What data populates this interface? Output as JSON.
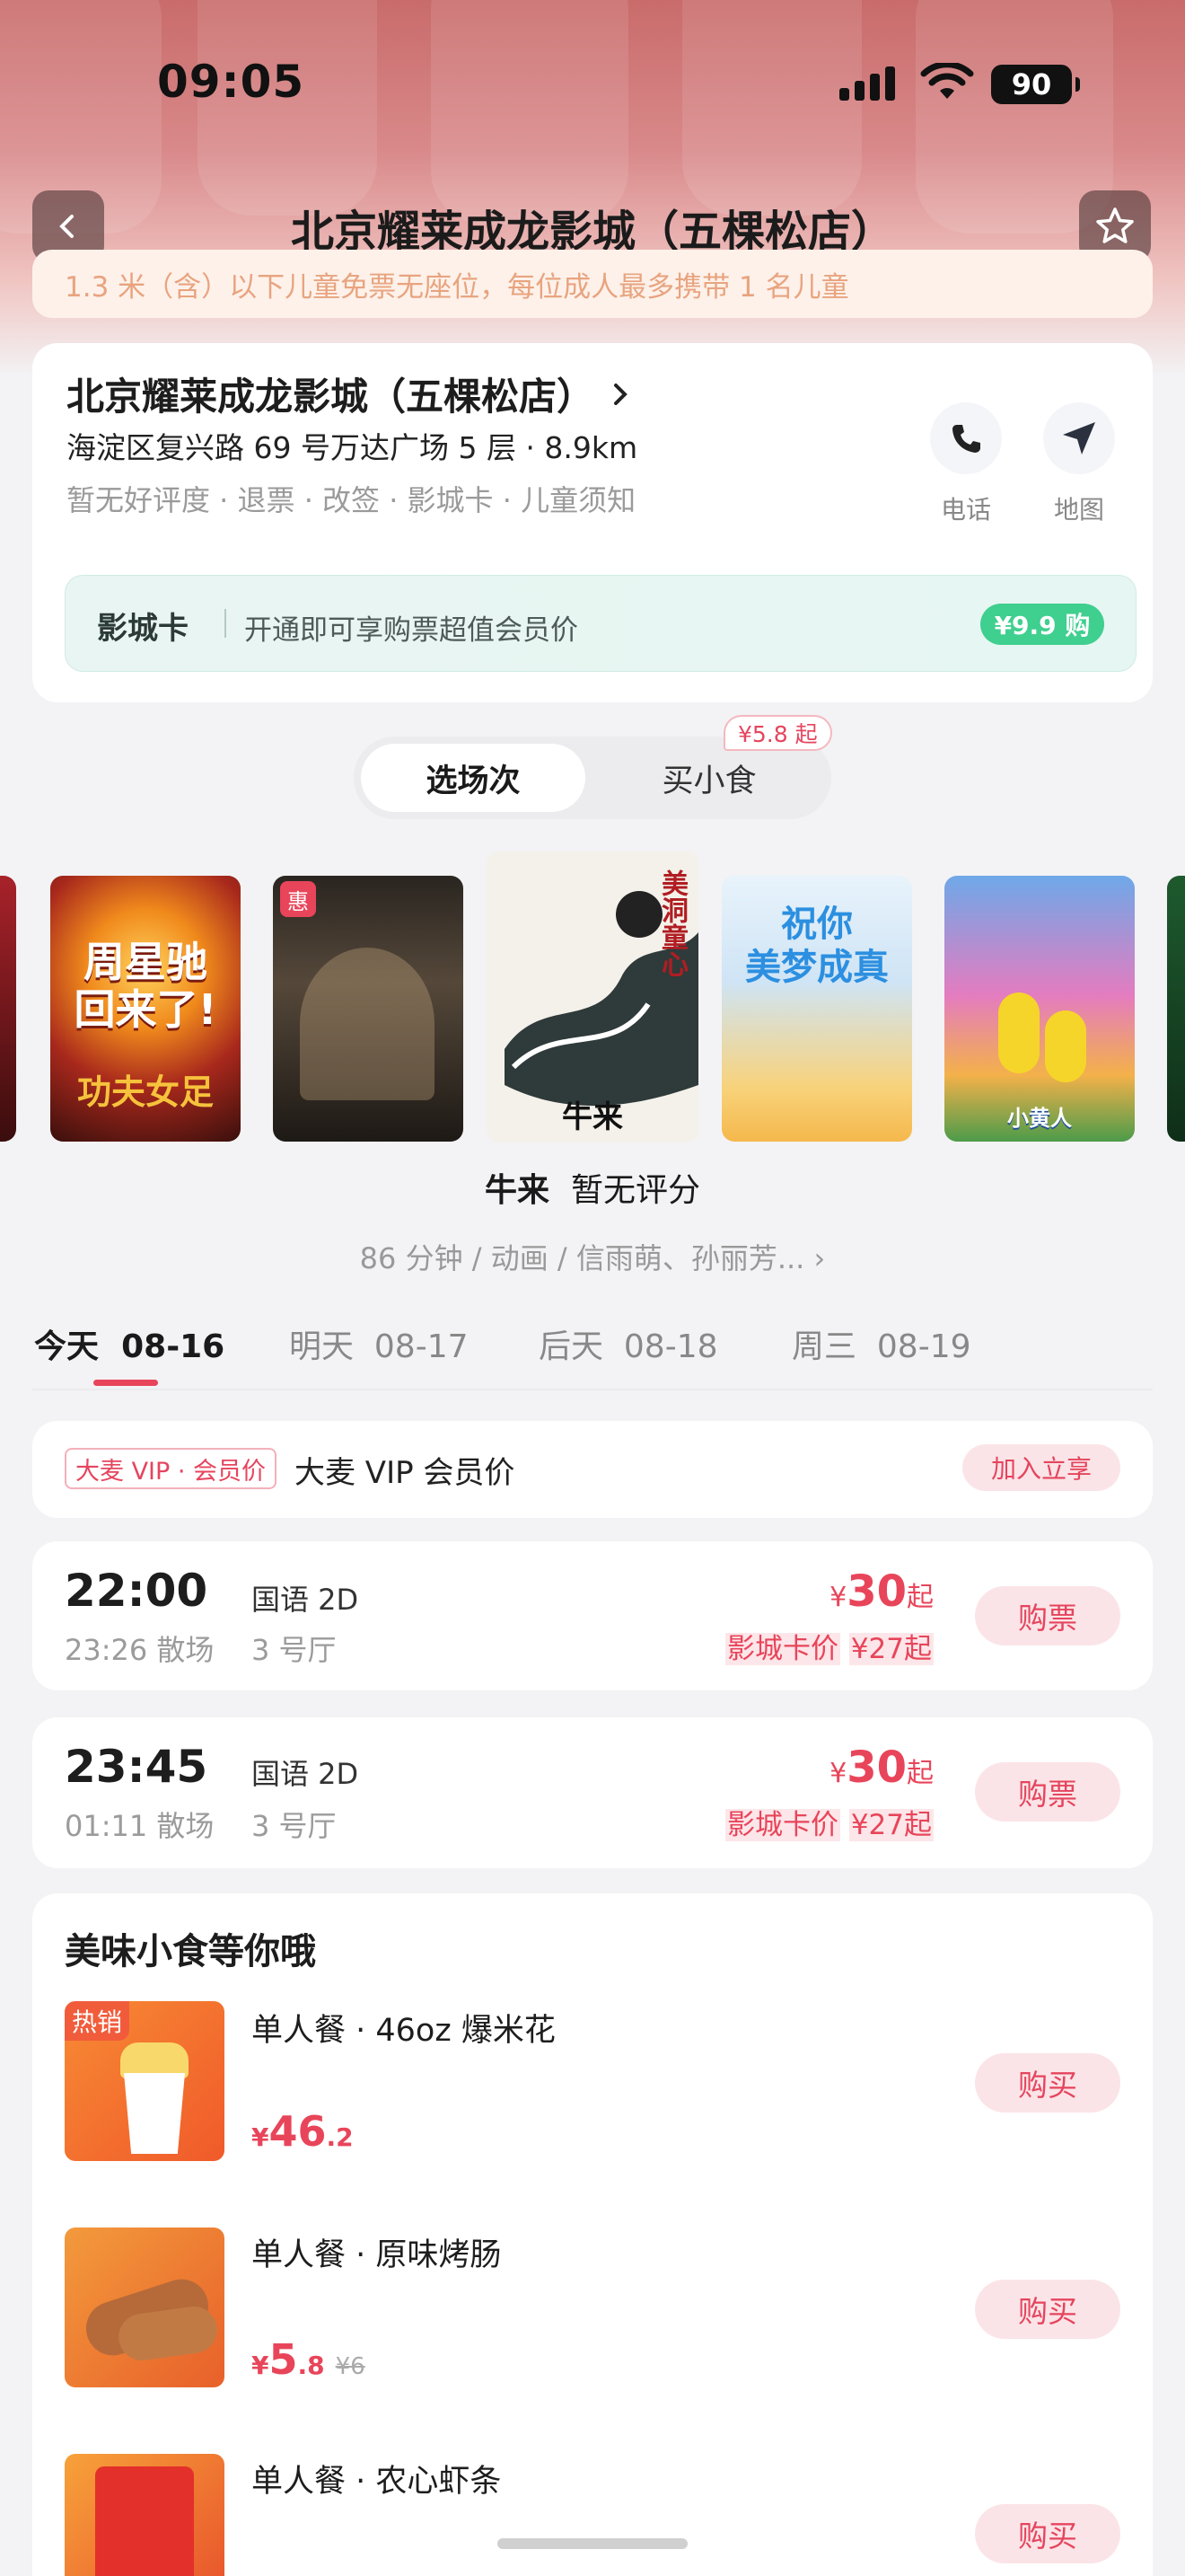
{
  "status_bar": {
    "time": "09:05",
    "battery": "90"
  },
  "header": {
    "title": "北京耀莱成龙影城（五棵松店）"
  },
  "notice": "1.3 米（含）以下儿童免票无座位，每位成人最多携带 1 名儿童",
  "cinema": {
    "name": "北京耀莱成龙影城（五棵松店）",
    "address": "海淀区复兴路 69 号万达广场 5 层 · 8.9km",
    "tags": "暂无好评度 · 退票 · 改签 · 影城卡 · 儿童须知",
    "phone_label": "电话",
    "map_label": "地图",
    "card_bar": {
      "title": "影城卡",
      "desc": "开通即可享购票超值会员价",
      "button": "¥9.9 购"
    }
  },
  "switch": {
    "active": "选场次",
    "inactive": "买小食",
    "badge": "¥5.8 起"
  },
  "posters": [
    {
      "text": "周星驰\n回来了!",
      "sub": "功夫女足",
      "hui": ""
    },
    {
      "text": "",
      "sub": "",
      "hui": "惠"
    },
    {
      "text": "美洞童心",
      "sub": "牛来",
      "hui": ""
    },
    {
      "text": "祝你\n美梦成真",
      "sub": "",
      "hui": ""
    },
    {
      "text": "",
      "sub": "小黄人",
      "hui": ""
    }
  ],
  "movie": {
    "title": "牛来",
    "rating": "暂无评分",
    "meta": "86 分钟 / 动画 / 信雨萌、孙丽芳... ›"
  },
  "dates": [
    {
      "day": "今天",
      "date": "08-16"
    },
    {
      "day": "明天",
      "date": "08-17"
    },
    {
      "day": "后天",
      "date": "08-18"
    },
    {
      "day": "周三",
      "date": "08-19"
    }
  ],
  "vip": {
    "tag": "大麦 VIP · 会员价",
    "text": "大麦 VIP 会员价",
    "button": "加入立享"
  },
  "shows": [
    {
      "time": "22:00",
      "end": "23:26 散场",
      "lang": "国语 2D",
      "hall": "3 号厅",
      "price": "30",
      "card_label": "影城卡价",
      "card_price": "¥27起",
      "button": "购票"
    },
    {
      "time": "23:45",
      "end": "01:11 散场",
      "lang": "国语 2D",
      "hall": "3 号厅",
      "price": "30",
      "card_label": "影城卡价",
      "card_price": "¥27起",
      "button": "购票"
    }
  ],
  "snacks": {
    "title": "美味小食等你哦",
    "items": [
      {
        "name": "单人餐 · 46oz 爆米花",
        "price_int": "46",
        "price_dec": ".2",
        "orig": "",
        "tag": "热销",
        "button": "购买"
      },
      {
        "name": "单人餐 · 原味烤肠",
        "price_int": "5",
        "price_dec": ".8",
        "orig": "¥6",
        "tag": "",
        "button": "购买"
      },
      {
        "name": "单人餐 · 农心虾条",
        "price_int": "",
        "price_dec": "",
        "orig": "",
        "tag": "",
        "button": "购买"
      }
    ]
  },
  "price_symbol": "¥",
  "price_suffix": "起",
  "colors": {
    "accent": "#e8455a",
    "green": "#3fcf8f"
  }
}
